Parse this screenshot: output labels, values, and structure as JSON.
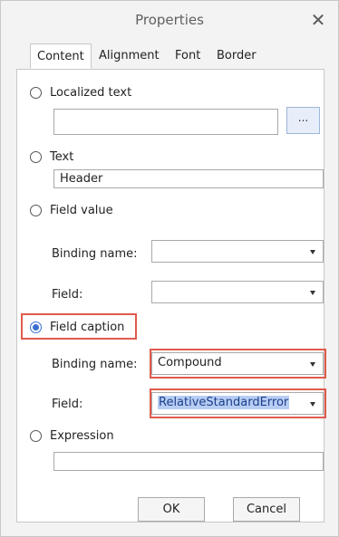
{
  "window": {
    "title": "Properties",
    "close_glyph": "✕"
  },
  "tabs": [
    {
      "label": "Content",
      "active": true
    },
    {
      "label": "Alignment",
      "active": false
    },
    {
      "label": "Font",
      "active": false
    },
    {
      "label": "Border",
      "active": false
    }
  ],
  "content": {
    "localized_text": {
      "label": "Localized text",
      "checked": false,
      "value": "",
      "browse_label": "..."
    },
    "text": {
      "label": "Text",
      "checked": false,
      "value": "Header"
    },
    "field_value": {
      "label": "Field value",
      "checked": false,
      "binding_label": "Binding name:",
      "binding_value": "",
      "field_label": "Field:",
      "field_value": ""
    },
    "field_caption": {
      "label": "Field caption",
      "checked": true,
      "binding_label": "Binding name:",
      "binding_value": "Compound",
      "field_label": "Field:",
      "field_value": "RelativeStandardError"
    },
    "expression": {
      "label": "Expression",
      "checked": false,
      "value": ""
    }
  },
  "buttons": {
    "ok": "OK",
    "cancel": "Cancel"
  },
  "colors": {
    "highlight": "#e05a4b",
    "radio_checked": "#3a6fd0",
    "selection": "#b7cdf3"
  }
}
